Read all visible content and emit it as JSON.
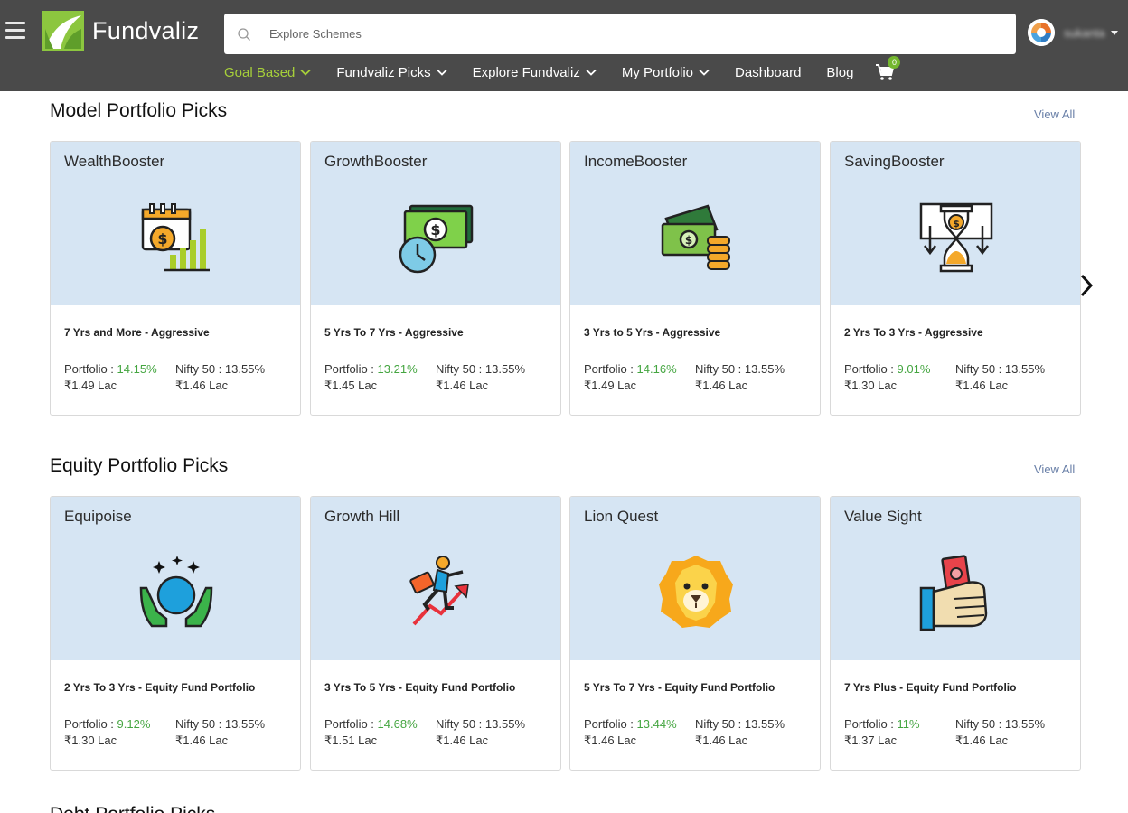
{
  "header": {
    "logo_text": "Fundvaliz",
    "search_placeholder": "Explore Schemes",
    "user_name": "sukanta",
    "cart_count": "0",
    "nav": [
      {
        "label": "Goal Based",
        "dropdown": true,
        "active": true
      },
      {
        "label": "Fundvaliz Picks",
        "dropdown": true
      },
      {
        "label": "Explore Fundvaliz",
        "dropdown": true
      },
      {
        "label": "My Portfolio",
        "dropdown": true
      },
      {
        "label": "Dashboard",
        "dropdown": false
      },
      {
        "label": "Blog",
        "dropdown": false
      }
    ]
  },
  "colors": {
    "header_bg": "#4a4a4a",
    "accent_green": "#a6cf3a",
    "return_green": "#44a540",
    "card_top": "#d6e5f3",
    "view_all": "#6a80a8"
  },
  "sections": [
    {
      "title": "Model Portfolio Picks",
      "view_all": "View All",
      "cards": [
        {
          "name": "WealthBooster",
          "icon": "wealth-calendar-chart-icon",
          "subtitle": "7 Yrs and More - Aggressive",
          "portfolio_label": "Portfolio : ",
          "portfolio_return": "14.15%",
          "portfolio_value": "₹1.49 Lac",
          "nifty_label": "Nifty 50 : 13.55%",
          "nifty_value": "₹1.46 Lac"
        },
        {
          "name": "GrowthBooster",
          "icon": "money-clock-icon",
          "subtitle": "5 Yrs To 7 Yrs - Aggressive",
          "portfolio_label": "Portfolio : ",
          "portfolio_return": "13.21%",
          "portfolio_value": "₹1.45 Lac",
          "nifty_label": "Nifty 50 : 13.55%",
          "nifty_value": "₹1.46 Lac"
        },
        {
          "name": "IncomeBooster",
          "icon": "cash-coins-icon",
          "subtitle": "3 Yrs to 5 Yrs - Aggressive",
          "portfolio_label": "Portfolio : ",
          "portfolio_return": "14.16%",
          "portfolio_value": "₹1.49 Lac",
          "nifty_label": "Nifty 50 : 13.55%",
          "nifty_value": "₹1.46 Lac"
        },
        {
          "name": "SavingBooster",
          "icon": "hourglass-money-icon",
          "subtitle": "2 Yrs To 3 Yrs - Aggressive",
          "portfolio_label": "Portfolio : ",
          "portfolio_return": "9.01%",
          "portfolio_value": "₹1.30 Lac",
          "nifty_label": "Nifty 50 : 13.55%",
          "nifty_value": "₹1.46 Lac"
        }
      ]
    },
    {
      "title": "Equity Portfolio Picks",
      "view_all": "View All",
      "cards": [
        {
          "name": "Equipoise",
          "icon": "hands-globe-icon",
          "subtitle": "2 Yrs To 3 Yrs - Equity Fund Portfolio",
          "portfolio_label": "Portfolio : ",
          "portfolio_return": "9.12%",
          "portfolio_value": "₹1.30 Lac",
          "nifty_label": "Nifty 50 : 13.55%",
          "nifty_value": "₹1.46 Lac"
        },
        {
          "name": "Growth Hill",
          "icon": "climbing-man-icon",
          "subtitle": "3 Yrs To 5 Yrs - Equity Fund Portfolio",
          "portfolio_label": "Portfolio : ",
          "portfolio_return": "14.68%",
          "portfolio_value": "₹1.51 Lac",
          "nifty_label": "Nifty 50 : 13.55%",
          "nifty_value": "₹1.46 Lac"
        },
        {
          "name": "Lion Quest",
          "icon": "lion-icon",
          "subtitle": "5 Yrs To 7 Yrs - Equity Fund Portfolio",
          "portfolio_label": "Portfolio : ",
          "portfolio_return": "13.44%",
          "portfolio_value": "₹1.46 Lac",
          "nifty_label": "Nifty 50 : 13.55%",
          "nifty_value": "₹1.46 Lac"
        },
        {
          "name": "Value Sight",
          "icon": "hand-money-icon",
          "subtitle": "7 Yrs Plus - Equity Fund Portfolio",
          "portfolio_label": "Portfolio : ",
          "portfolio_return": "11%",
          "portfolio_value": "₹1.37 Lac",
          "nifty_label": "Nifty 50 : 13.55%",
          "nifty_value": "₹1.46 Lac"
        }
      ]
    },
    {
      "title": "Debt Portfolio Picks"
    }
  ]
}
